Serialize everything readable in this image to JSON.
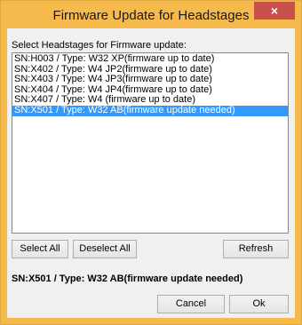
{
  "window": {
    "title": "Firmware Update for Headstages",
    "close_glyph": "×"
  },
  "list": {
    "caption": "Select Headstages for Firmware update:",
    "items": [
      "SN:H003 / Type: W32 XP(firmware up to date)",
      "SN:X402 / Type: W4 JP2(firmware up to date)",
      "SN:X403 / Type: W4 JP3(firmware up to date)",
      "SN:X404 / Type: W4 JP4(firmware up to date)",
      "SN:X407 / Type: W4 (firmware up to date)",
      "SN:X501 / Type: W32 AB(firmware update needed)"
    ],
    "selected_index": 5
  },
  "buttons": {
    "select_all": "Select All",
    "deselect_all": "Deselect All",
    "refresh": "Refresh",
    "cancel": "Cancel",
    "ok": "Ok"
  },
  "status_text": "SN:X501 / Type: W32 AB(firmware update needed)",
  "colors": {
    "titlebar": "#f6b94c",
    "close": "#c7504a",
    "selection": "#3399ff"
  }
}
